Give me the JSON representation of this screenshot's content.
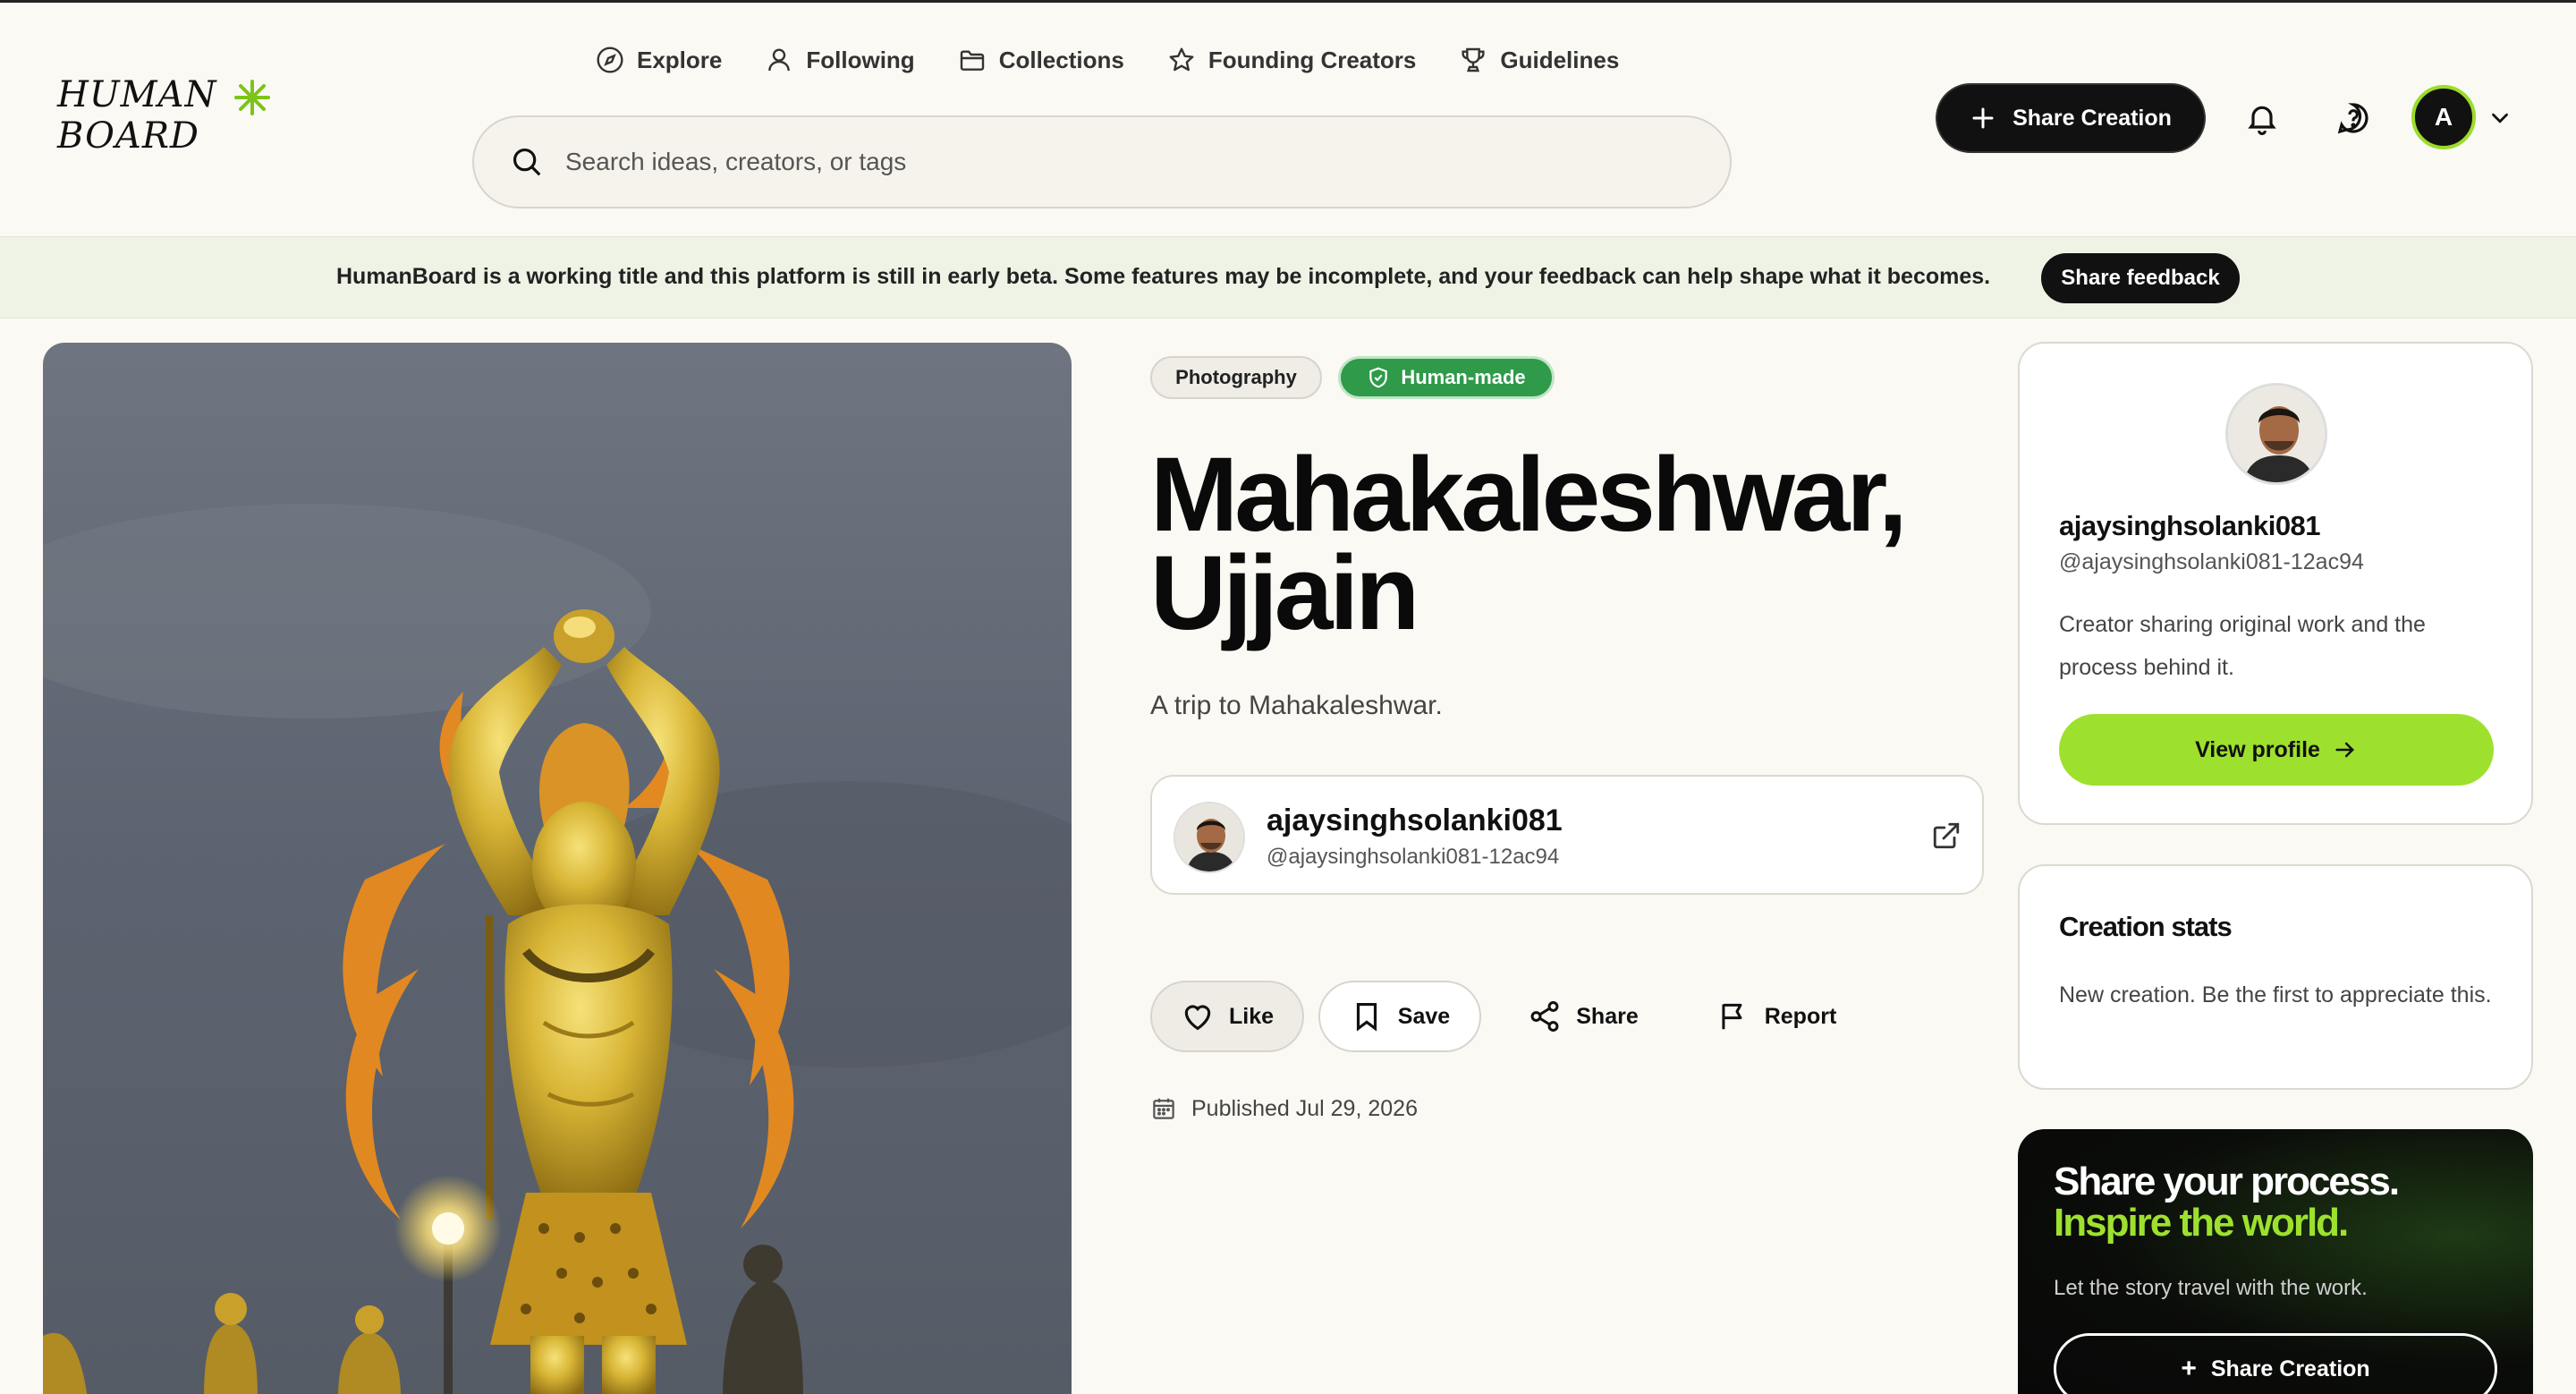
{
  "brand": {
    "logo_line1": "HUMAN",
    "logo_line2": "BOARD",
    "accent": "#9de12e"
  },
  "nav": {
    "items": [
      {
        "label": "Explore",
        "icon": "compass-icon"
      },
      {
        "label": "Following",
        "icon": "user-icon"
      },
      {
        "label": "Collections",
        "icon": "folder-icon"
      },
      {
        "label": "Founding Creators",
        "icon": "star-icon"
      },
      {
        "label": "Guidelines",
        "icon": "trophy-icon"
      }
    ]
  },
  "search": {
    "placeholder": "Search ideas, creators, or tags",
    "value": ""
  },
  "header": {
    "share_label": "Share Creation",
    "notifications_icon": "bell-icon",
    "help_icon": "help-circle-icon",
    "avatar_initial": "A"
  },
  "beta": {
    "message": "HumanBoard is a working title and this platform is still in early beta. Some features may be incomplete, and your feedback can help shape what it becomes.",
    "button_label": "Share feedback"
  },
  "creation": {
    "tags": {
      "category": "Photography",
      "badge": "Human-made"
    },
    "title": "Mahakaleshwar, Ujjain",
    "description": "A trip to Mahakaleshwar.",
    "creator": {
      "name": "ajaysinghsolanki081",
      "handle": "@ajaysinghsolanki081-12ac94"
    },
    "actions": {
      "like": "Like",
      "save": "Save",
      "share": "Share",
      "report": "Report"
    },
    "published": "Published Jul 29, 2026"
  },
  "sidebar": {
    "profile": {
      "name": "ajaysinghsolanki081",
      "handle": "@ajaysinghsolanki081-12ac94",
      "bio": "Creator sharing original work and the process behind it.",
      "button_label": "View profile"
    },
    "stats": {
      "title": "Creation stats",
      "text": "New creation. Be the first to appreciate this."
    },
    "promo": {
      "line1": "Share your process.",
      "line2": "Inspire the world.",
      "text": "Let the story travel with the work.",
      "button_label": "Share Creation"
    }
  }
}
